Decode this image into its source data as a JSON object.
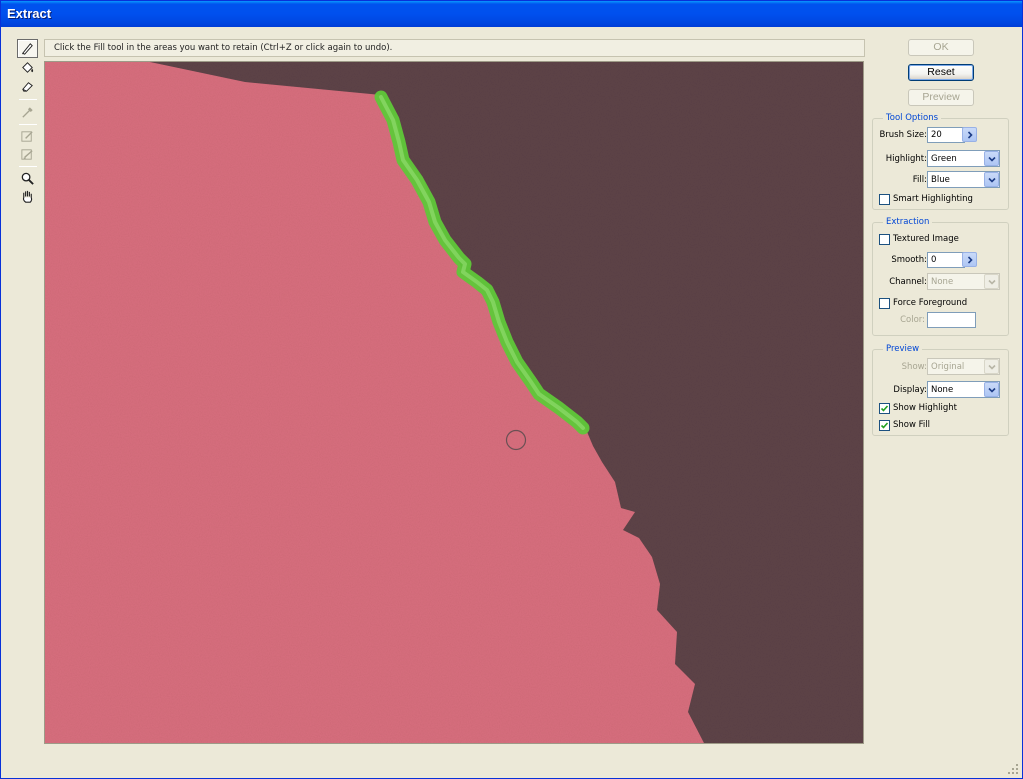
{
  "window": {
    "title": "Extract"
  },
  "toolbar": {
    "tools": [
      {
        "id": "edge-highlighter",
        "icon": "highlighter-icon",
        "active": true
      },
      {
        "id": "fill",
        "icon": "paint-bucket-icon",
        "active": false
      },
      {
        "id": "eraser",
        "icon": "eraser-icon",
        "active": false
      },
      {
        "id": "eyedropper",
        "icon": "eyedropper-icon",
        "active": false,
        "disabled": true
      },
      {
        "id": "cleanup",
        "icon": "cleanup-icon",
        "active": false,
        "disabled": true
      },
      {
        "id": "edge-touchup",
        "icon": "edge-touchup-icon",
        "active": false,
        "disabled": true
      },
      {
        "id": "zoom",
        "icon": "magnifier-icon",
        "active": false
      },
      {
        "id": "hand",
        "icon": "hand-icon",
        "active": false
      }
    ]
  },
  "hint": "Click the Fill tool in the areas you want to retain (Ctrl+Z or click again to undo).",
  "buttons": {
    "ok": "OK",
    "reset": "Reset",
    "preview": "Preview"
  },
  "tool_options": {
    "title": "Tool Options",
    "brush_size_label": "Brush Size:",
    "brush_size": "20",
    "highlight_label": "Highlight:",
    "highlight": "Green",
    "fill_label": "Fill:",
    "fill": "Blue",
    "smart_highlighting_label": "Smart Highlighting",
    "smart_highlighting": false
  },
  "extraction": {
    "title": "Extraction",
    "textured_image_label": "Textured Image",
    "textured_image": false,
    "smooth_label": "Smooth:",
    "smooth": "0",
    "channel_label": "Channel:",
    "channel": "None",
    "force_foreground_label": "Force Foreground",
    "force_foreground": false,
    "color_label": "Color:"
  },
  "preview": {
    "title": "Preview",
    "show_label": "Show:",
    "show": "Original",
    "display_label": "Display:",
    "display": "None",
    "show_highlight_label": "Show Highlight",
    "show_highlight": true,
    "show_fill_label": "Show Fill",
    "show_fill": true
  },
  "colors": {
    "accent": "#0046d5",
    "titlebar": "#0053ee",
    "pink_paper": "#d96f7f",
    "dark_background": "#5e4448",
    "highlight_stroke": "#5fc839"
  }
}
